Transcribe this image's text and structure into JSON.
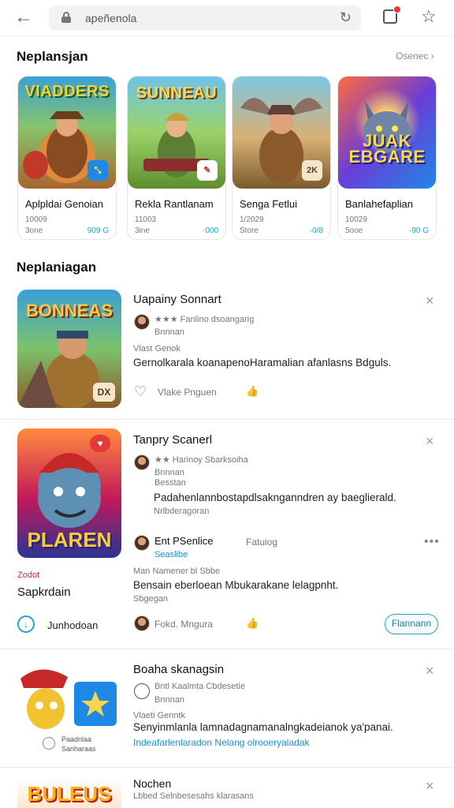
{
  "browser": {
    "back_icon": "back-arrow-icon",
    "url": "apeñenola",
    "lock_icon": "lock-icon",
    "reload_icon": "reload-icon",
    "reload_glyph": "↻",
    "back_glyph": "←",
    "star_glyph": "☆"
  },
  "section1": {
    "title": "Neplansjan",
    "more": "Osenec ›"
  },
  "cards": [
    {
      "art_title": "VIADDERS",
      "badge": "⤡",
      "name": "Aplpldai Genoian",
      "sub1": "10009",
      "sub2": "3one",
      "value": "909 G"
    },
    {
      "art_title": "SUNNEAU",
      "badge": "✎",
      "name": "Rekla Rantlanam",
      "sub1": "11003",
      "sub2": "3ine",
      "value": "·000"
    },
    {
      "art_title": "",
      "badge": "2K",
      "name": "Senga Fetlui",
      "sub1": "1/2029",
      "sub2": "Store",
      "value": "·0/8"
    },
    {
      "art_title": "JUAK EBGARE",
      "badge": "",
      "name": "Banlahefaplian",
      "sub1": "10029",
      "sub2": "5ooe",
      "value": "·90 G"
    }
  ],
  "section2": {
    "title": "Neplaniagan"
  },
  "items": [
    {
      "art_title": "BONNEAS",
      "title": "Uapainy Sonnart",
      "close": "×",
      "meta1": "★★★ Fanlino dsoangarig",
      "meta2": "Bnnnan",
      "meta3": "Vlast Genok",
      "desc": "Gernolkarala koanapenoHaramalian afanlasns Bdguls.",
      "like_label": "Vlake Pnguen"
    },
    {
      "art_title": "PLAREN",
      "title": "Tanpry Scanerl",
      "close": "×",
      "meta1": "★★ Harinoy Sbarksoiha",
      "meta2": "Bnnnan",
      "meta3": "Besstan",
      "desc": "Padahenlannbostapdlsaknganndren ay baeglierald.",
      "desc_sub": "Nrlbderagoran",
      "reply_name": "Ent PSenlice",
      "reply_badge": "Seaslibe",
      "reply_action": "Fatuiog",
      "reply_meta": "Man Namener bl Sbbe",
      "reply_desc": "Bensain eberloean Mbukarakane lelagpnht.",
      "reply_desc2": "Sbgegan",
      "reply_footer_name": "Fokd. Mngura",
      "follow": "Flannann",
      "side_label": "Zodot",
      "side_name": "Sapkrdain",
      "side_action": "Junhodoan"
    },
    {
      "title": "Boaha skanagsin",
      "close": "×",
      "meta1": "Bntl Kaalmta Cbdesetie",
      "meta2": "Bnnnan",
      "meta3": "Vlaeti Genntk",
      "desc": "Senyinmlanla lamnadagnamanalngkadeianok ya'panai.",
      "link": "Indeafarlenlaradon Nelang olrooeryaladak",
      "art_caption1": "Paadnlaa",
      "art_caption2": "Sanharaas"
    },
    {
      "art_title": "BULEUS",
      "title": "Nochen",
      "close": "×",
      "meta1": "Lbbed Selnbesesahs klarasans"
    }
  ]
}
